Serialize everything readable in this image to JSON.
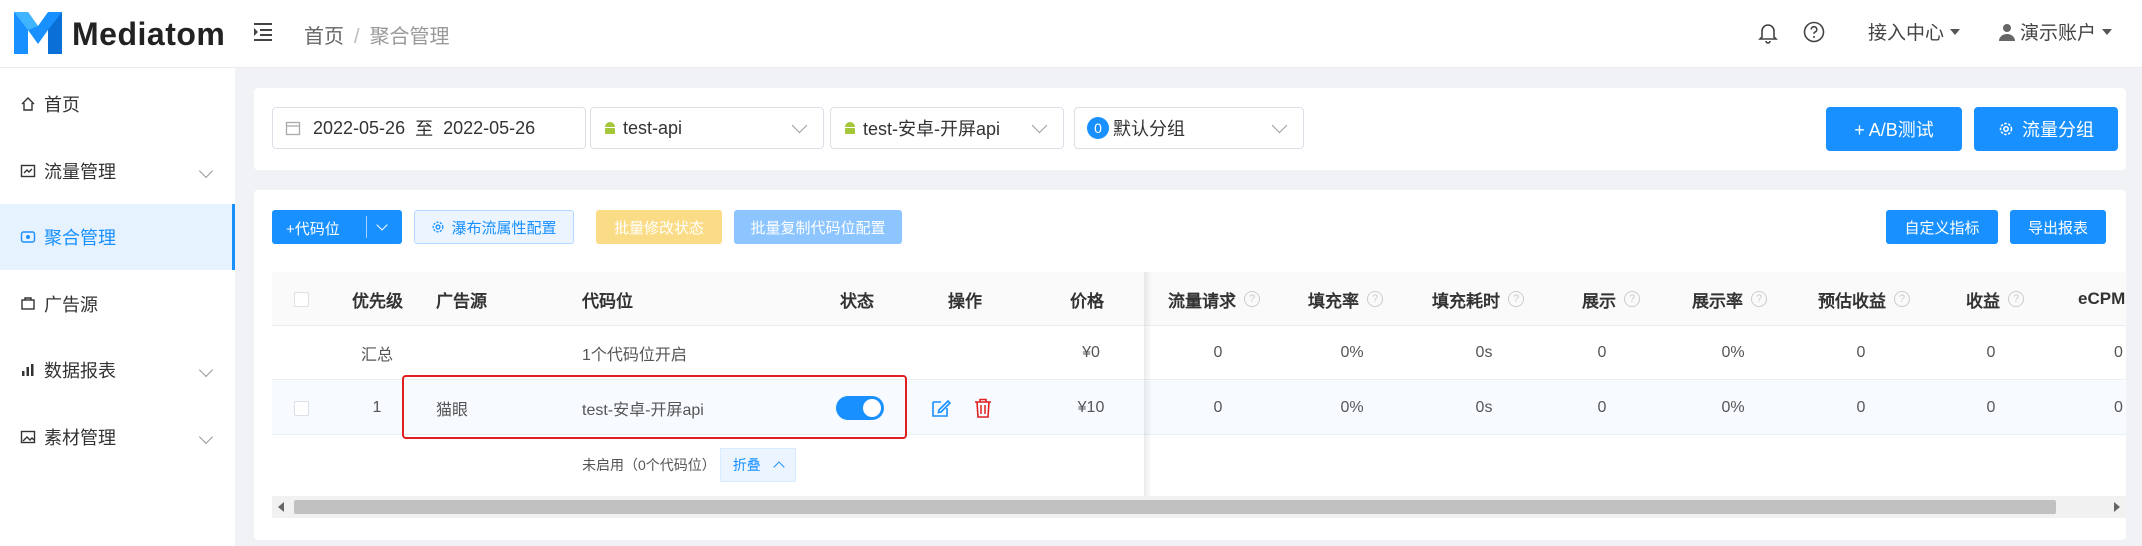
{
  "app": {
    "name": "Mediatom"
  },
  "breadcrumb": {
    "home": "首页",
    "separator": "/",
    "current": "聚合管理"
  },
  "header": {
    "access_center": "接入中心",
    "account": "演示账户",
    "icons": [
      "bell-icon",
      "help-icon",
      "user-icon"
    ]
  },
  "sidebar": {
    "items": [
      {
        "label": "首页",
        "icon": "home-icon",
        "has_children": false,
        "active": false
      },
      {
        "label": "流量管理",
        "icon": "traffic-icon",
        "has_children": true,
        "active": false
      },
      {
        "label": "聚合管理",
        "icon": "aggregate-icon",
        "has_children": false,
        "active": true
      },
      {
        "label": "广告源",
        "icon": "ad-source-icon",
        "has_children": false,
        "active": false
      },
      {
        "label": "数据报表",
        "icon": "report-icon",
        "has_children": true,
        "active": false
      },
      {
        "label": "素材管理",
        "icon": "material-icon",
        "has_children": true,
        "active": false
      }
    ]
  },
  "filters": {
    "date_start": "2022-05-26",
    "date_to": "至",
    "date_end": "2022-05-26",
    "app_select": "test-api",
    "placement_select": "test-安卓-开屏api",
    "group_badge": "0",
    "group_select": "默认分组",
    "ab_test_button": "+ A/B测试",
    "traffic_group_button": "流量分组"
  },
  "toolbar": {
    "add_code": "+代码位",
    "waterfall_config": "瀑布流属性配置",
    "batch_status": "批量修改状态",
    "batch_copy": "批量复制代码位配置",
    "custom_metrics": "自定义指标",
    "export_report": "导出报表"
  },
  "table": {
    "columns": {
      "priority": "优先级",
      "ad_source": "广告源",
      "code": "代码位",
      "status": "状态",
      "ops": "操作",
      "price": "价格",
      "requests": "流量请求",
      "fill_rate": "填充率",
      "fill_time": "填充耗时",
      "impressions": "展示",
      "show_rate": "展示率",
      "est_revenue": "预估收益",
      "revenue": "收益",
      "ecpm": "eCPM"
    },
    "summary": {
      "label": "汇总",
      "code": "1个代码位开启",
      "price": "¥0",
      "requests": "0",
      "fill_rate": "0%",
      "fill_time": "0s",
      "impressions": "0",
      "show_rate": "0%",
      "est_revenue": "0",
      "revenue": "0",
      "ecpm": "0"
    },
    "rows": [
      {
        "priority": "1",
        "ad_source": "猫眼",
        "code": "test-安卓-开屏api",
        "status_on": true,
        "price": "¥10",
        "requests": "0",
        "fill_rate": "0%",
        "fill_time": "0s",
        "impressions": "0",
        "show_rate": "0%",
        "est_revenue": "0",
        "revenue": "0",
        "ecpm": "0"
      }
    ],
    "disabled_note": "未启用（0个代码位）",
    "fold_button": "折叠"
  },
  "colors": {
    "primary": "#1890ff",
    "danger": "#e02020",
    "warning_light": "#fbdc86"
  }
}
